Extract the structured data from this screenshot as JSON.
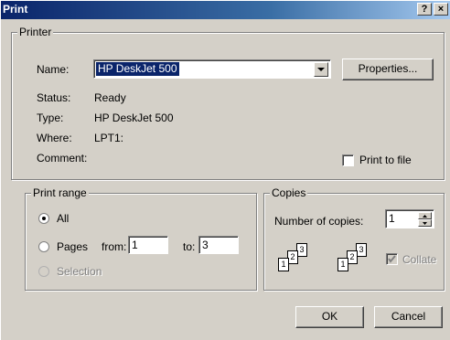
{
  "window": {
    "title": "Print",
    "help_btn": "?",
    "close_btn": "×"
  },
  "printer": {
    "group_label": "Printer",
    "name_label": "Name:",
    "name_value": "HP DeskJet 500",
    "properties_btn": "Properties...",
    "status_label": "Status:",
    "status_value": "Ready",
    "type_label": "Type:",
    "type_value": "HP DeskJet 500",
    "where_label": "Where:",
    "where_value": "LPT1:",
    "comment_label": "Comment:",
    "print_to_file_label": "Print to file",
    "print_to_file_checked": false
  },
  "print_range": {
    "group_label": "Print range",
    "all_label": "All",
    "pages_label": "Pages",
    "from_label": "from:",
    "from_value": "1",
    "to_label": "to:",
    "to_value": "3",
    "selection_label": "Selection",
    "selected": "All"
  },
  "copies": {
    "group_label": "Copies",
    "number_label": "Number of copies:",
    "number_value": "1",
    "collate_label": "Collate",
    "collate_checked": true,
    "collate_enabled": false,
    "page_numbers": [
      "1",
      "2",
      "3"
    ]
  },
  "buttons": {
    "ok": "OK",
    "cancel": "Cancel"
  },
  "colors": {
    "titlebar_start": "#0a246a",
    "face": "#d4d0c8",
    "selection": "#0a246a"
  }
}
